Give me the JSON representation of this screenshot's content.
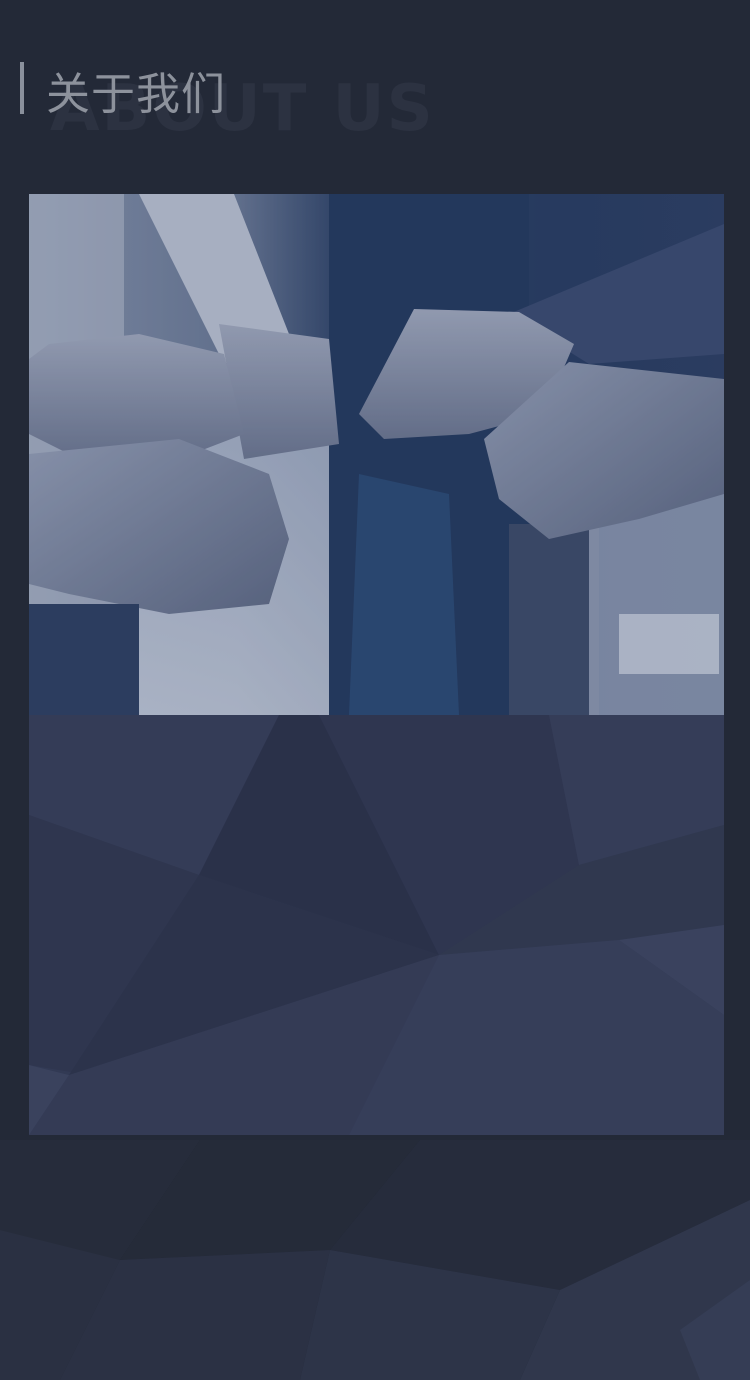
{
  "header": {
    "title": "关于我们",
    "watermark": "ABOUT US"
  },
  "card": {
    "image": "team-fist-bump-photo"
  },
  "colors": {
    "background": "#232937",
    "card": "#323a54",
    "title": "#8d929c",
    "accent_bar": "#8a909c"
  }
}
